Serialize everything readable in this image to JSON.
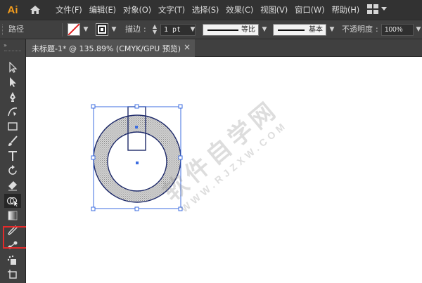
{
  "app": {
    "logo": "Ai",
    "menu": [
      "文件(F)",
      "编辑(E)",
      "对象(O)",
      "文字(T)",
      "选择(S)",
      "效果(C)",
      "视图(V)",
      "窗口(W)",
      "帮助(H)"
    ]
  },
  "control_bar": {
    "selection_label": "路径",
    "stroke_label": "描边",
    "stroke_weight": "1 pt",
    "stroke_profile_label": "等比",
    "brush_label": "基本",
    "opacity_label": "不透明度",
    "opacity_value": "100%"
  },
  "document": {
    "tab_title": "未标题-1* @ 135.89% (CMYK/GPU 预览)",
    "close_glyph": "×"
  },
  "watermark": {
    "main": "软件自学网",
    "sub": "WWW.RJZXW.COM"
  },
  "icons": {
    "home": "home-icon",
    "workspace": "workspace-grid-icon",
    "fill_none": "fill-none-icon",
    "stroke": "stroke-swatch-icon"
  },
  "colors": {
    "logo": "#f49d1d",
    "selection": "#3d6de0",
    "highlight": "#e32b2b",
    "ring_fill": "#c9c9c9",
    "ring_stroke": "#1e2a6a"
  }
}
